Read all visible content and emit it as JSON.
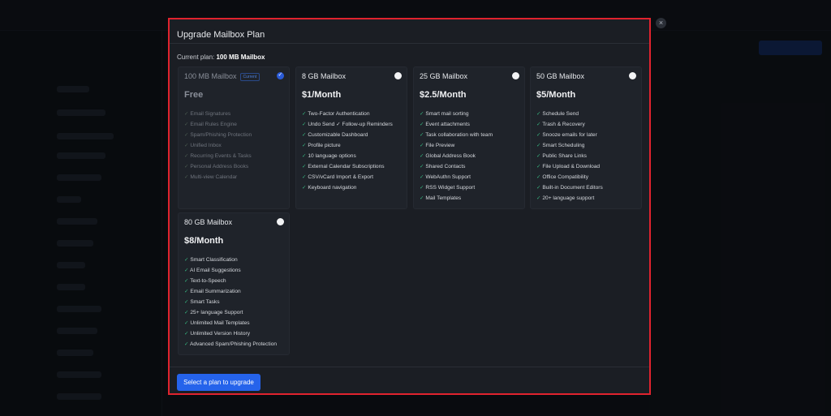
{
  "modal": {
    "title": "Upgrade Mailbox Plan",
    "close": "×",
    "current_label": "Current plan:",
    "current_value": "100 MB Mailbox",
    "cta": "Select a plan to upgrade"
  },
  "plans": [
    {
      "name": "100 MB Mailbox",
      "badge": "Current",
      "price": "Free",
      "selected": true,
      "features": [
        "Email Signatures",
        "Email Rules Engine",
        "Spam/Phishing Protection",
        "Unified Inbox",
        "Recurring Events & Tasks",
        "Personal Address Books",
        "Multi-view Calendar"
      ]
    },
    {
      "name": "8 GB Mailbox",
      "price": "$1/Month",
      "selected": false,
      "features": [
        "Two-Factor Authentication",
        "Undo Send  ✓ Follow-up Reminders",
        "Customizable Dashboard",
        "Profile picture",
        "10 language options",
        "External Calendar Subscriptions",
        "CSV/vCard Import & Export",
        "Keyboard navigation"
      ]
    },
    {
      "name": "25 GB Mailbox",
      "price": "$2.5/Month",
      "selected": false,
      "features": [
        "Smart mail sorting",
        "Event attachments",
        "Task collaboration with team",
        "File Preview",
        "Global Address Book",
        "Shared Contacts",
        "WebAuthn Support",
        "RSS Widget Support",
        "Mail Templates"
      ]
    },
    {
      "name": "50 GB Mailbox",
      "price": "$5/Month",
      "selected": false,
      "features": [
        "Schedule Send",
        "Trash & Recovery",
        "Snooze emails for later",
        "Smart Scheduling",
        "Public Share Links",
        "File Upload & Download",
        "Office Compatibility",
        "Built-in Document Editors",
        "20+ language support"
      ]
    },
    {
      "name": "80 GB Mailbox",
      "price": "$8/Month",
      "selected": false,
      "features": [
        "Smart Classification",
        "AI Email Suggestions",
        "Text-to-Speech",
        "Email Summarization",
        "Smart Tasks",
        "25+ language Support",
        "Unlimited Mail Templates",
        "Unlimited Version History",
        "Advanced Spam/Phishing Protection"
      ]
    }
  ]
}
